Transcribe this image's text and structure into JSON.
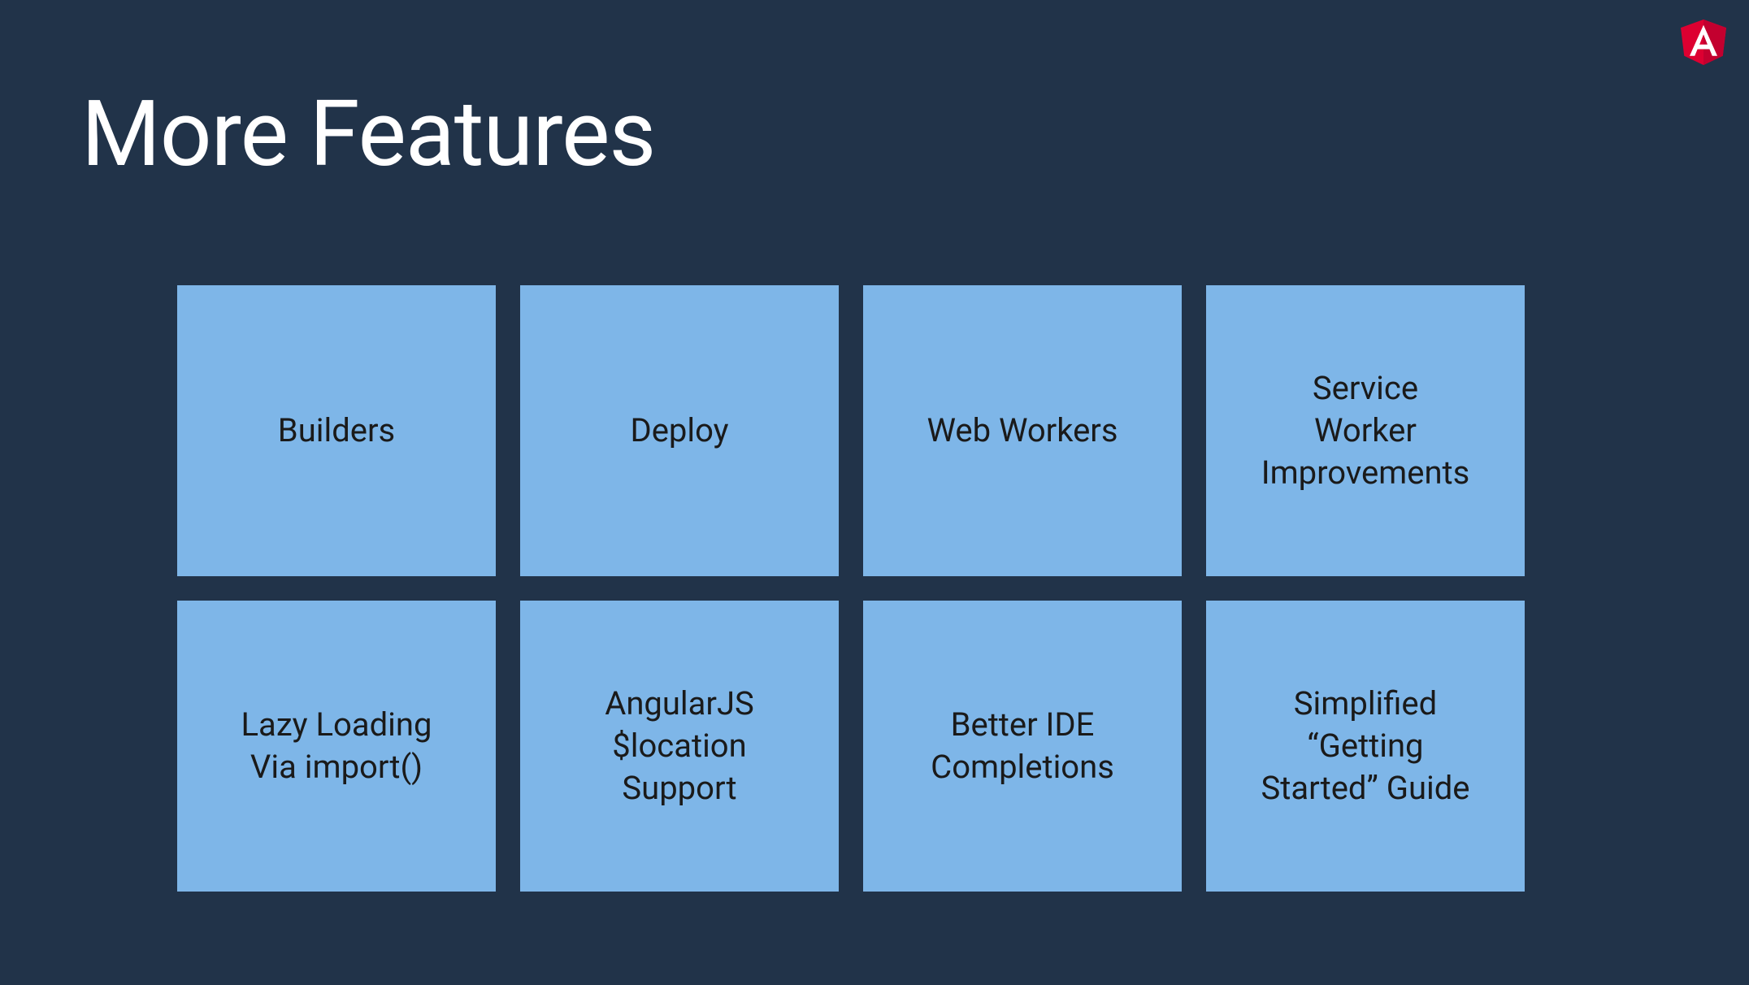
{
  "title": "More Features",
  "tiles": [
    {
      "label": "Builders"
    },
    {
      "label": "Deploy"
    },
    {
      "label": "Web Workers"
    },
    {
      "label": "Service\nWorker\nImprovements"
    },
    {
      "label": "Lazy Loading\nVia import()"
    },
    {
      "label": "AngularJS\n$location\nSupport"
    },
    {
      "label": "Better IDE\nCompletions"
    },
    {
      "label": "Simplified\n“Getting\nStarted” Guide"
    }
  ]
}
